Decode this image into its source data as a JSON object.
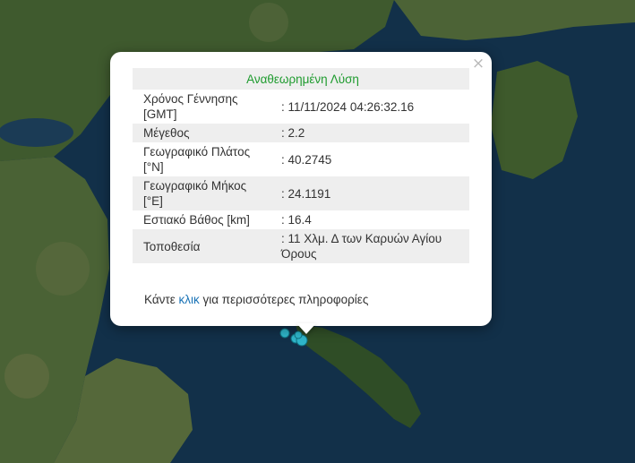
{
  "popup": {
    "title": "Αναθεωρημένη Λύση",
    "close_symbol": "×",
    "rows": [
      {
        "label": "Χρόνος Γέννησης [GMT]",
        "value": ": 11/11/2024 04:26:32.16"
      },
      {
        "label": "Μέγεθος",
        "value": ": 2.2"
      },
      {
        "label": "Γεωγραφικό Πλάτος [°N]",
        "value": ": 40.2745"
      },
      {
        "label": "Γεωγραφικό Μήκος [°E]",
        "value": ": 24.1191"
      },
      {
        "label": "Εστιακό Βάθος [km]",
        "value": ": 16.4"
      },
      {
        "label": "Τοποθεσία",
        "value": ": 11 Χλμ. Δ των Καρυών Αγίου Όρους"
      }
    ],
    "footer": {
      "prefix": "Κάντε ",
      "link": "κλικ",
      "suffix": " για περισσότερες πληροφορίες"
    }
  },
  "colors": {
    "title_green": "#1e9b2e",
    "link_blue": "#1a73b6",
    "marker": "#2fb5c9",
    "sea": "#123049"
  }
}
